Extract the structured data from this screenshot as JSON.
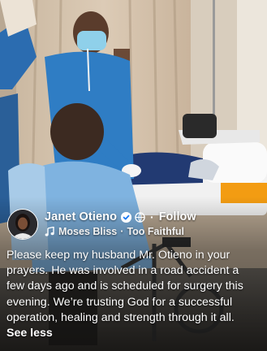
{
  "post": {
    "author_name": "Janet Otieno",
    "follow_label": "Follow",
    "separator": "·",
    "music": {
      "artist": "Moses Bliss",
      "separator": "·",
      "song": "Too Faithful"
    },
    "caption": "Please keep my husband Mr. Otieno in your prayers. He was involved in a road accident a few days ago and is scheduled for surgery this evening. We’re trusting God for a successful operation, healing and strength through it all.",
    "see_less_label": "See less"
  },
  "icons": {
    "verified": "verified-badge-icon",
    "privacy": "globe-icon",
    "music": "music-note-icon"
  },
  "colors": {
    "text": "#ffffff",
    "badge_check": "#1877f2"
  }
}
